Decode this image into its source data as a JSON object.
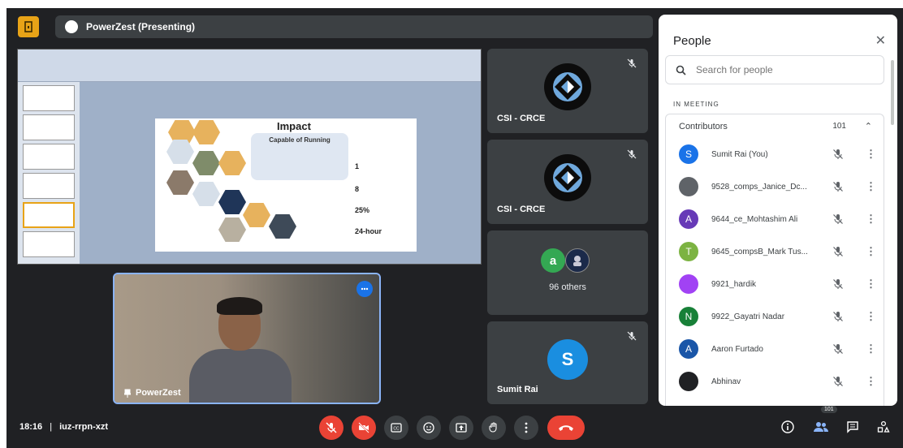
{
  "caption_fragment": "",
  "meeting": {
    "presenter_label": "PowerZest (Presenting)",
    "time": "18:16",
    "separator": "|",
    "code": "iuz-rrpn-xzt"
  },
  "slide": {
    "title": "Impact",
    "subtitle": "Capable of Running",
    "stat1": "1",
    "stat2": "8",
    "stat3": "25%",
    "stat4": "24-hour"
  },
  "self_view": {
    "name": "PowerZest"
  },
  "tiles": [
    {
      "name": "CSI - CRCE"
    },
    {
      "name": "CSI - CRCE"
    },
    {
      "avatar_letter": "a",
      "label": "96 others"
    },
    {
      "avatar_letter": "S",
      "name": "Sumit Rai"
    }
  ],
  "people": {
    "title": "People",
    "search_placeholder": "Search for people",
    "section": "IN MEETING",
    "group_label": "Contributors",
    "group_count": "101",
    "items": [
      {
        "name": "Sumit Rai (You)",
        "initial": "S",
        "color": "#1a73e8"
      },
      {
        "name": "9528_comps_Janice_Dc...",
        "initial": "",
        "color": "#5f6368"
      },
      {
        "name": "9644_ce_Mohtashim Ali",
        "initial": "A",
        "color": "#673ab7"
      },
      {
        "name": "9645_compsB_Mark Tus...",
        "initial": "T",
        "color": "#7cb342"
      },
      {
        "name": "9921_hardik",
        "initial": "",
        "color": "#a142f4"
      },
      {
        "name": "9922_Gayatri Nadar",
        "initial": "N",
        "color": "#188038"
      },
      {
        "name": "Aaron Furtado",
        "initial": "A",
        "color": "#1a56a8"
      },
      {
        "name": "Abhinav",
        "initial": "",
        "color": "#202124"
      }
    ]
  },
  "participant_badge": "101",
  "colors": {
    "accent": "#8ab4f8",
    "danger": "#ea4335",
    "panel_bg": "#202124",
    "tile_bg": "#3c4043"
  }
}
